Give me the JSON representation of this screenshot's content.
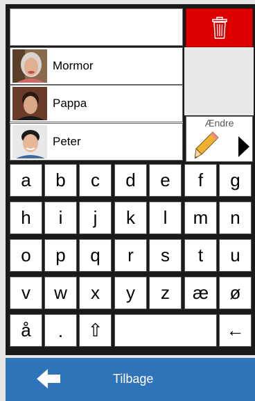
{
  "input": {
    "value": ""
  },
  "contacts": [
    {
      "name": "Mormor"
    },
    {
      "name": "Pappa"
    },
    {
      "name": "Peter"
    }
  ],
  "edit": {
    "label": "Ændre"
  },
  "keyboard": {
    "rows": [
      [
        "a",
        "b",
        "c",
        "d",
        "e",
        "f",
        "g"
      ],
      [
        "h",
        "i",
        "j",
        "k",
        "l",
        "m",
        "n"
      ],
      [
        "o",
        "p",
        "q",
        "r",
        "s",
        "t",
        "u"
      ],
      [
        "v",
        "w",
        "x",
        "y",
        "z",
        "æ",
        "ø"
      ]
    ],
    "last_row": {
      "aa": "å",
      "dot": ".",
      "shift": "⇧",
      "space": "",
      "backspace": "←"
    }
  },
  "back": {
    "label": "Tilbage"
  },
  "colors": {
    "trash": "#dd0000",
    "bottom_bar": "#2f73b8"
  }
}
